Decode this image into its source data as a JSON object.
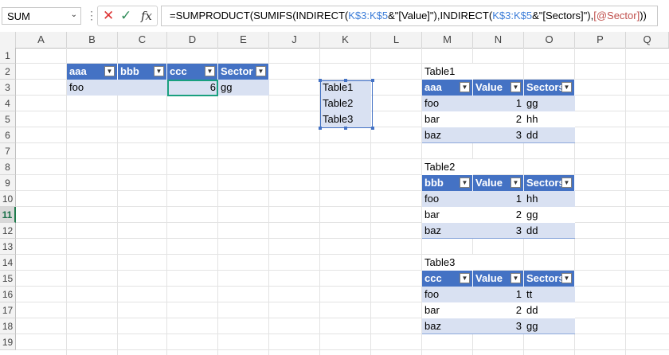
{
  "formula_bar": {
    "name_box": "SUM",
    "formula_parts": [
      {
        "text": "=SUMPRODUCT(SUMIFS(INDIRECT(",
        "c": ""
      },
      {
        "text": "K$3:K$5",
        "c": "ref"
      },
      {
        "text": "&\"[Value]\"),INDIRECT(",
        "c": ""
      },
      {
        "text": "K$3:K$5",
        "c": "ref"
      },
      {
        "text": "&\"[Sectors]\"),",
        "c": ""
      },
      {
        "text": "[@Sector]",
        "c": "ref2"
      },
      {
        "text": "))",
        "c": ""
      }
    ]
  },
  "columns": [
    "A",
    "B",
    "C",
    "D",
    "E",
    "J",
    "K",
    "L",
    "M",
    "N",
    "O",
    "P",
    "Q"
  ],
  "rows": [
    "1",
    "2",
    "3",
    "4",
    "5",
    "6",
    "7",
    "8",
    "9",
    "10",
    "11",
    "12",
    "13",
    "14",
    "15",
    "16",
    "17",
    "18",
    "19"
  ],
  "active_row": "11",
  "main_table": {
    "headers": [
      "aaa",
      "bbb",
      "ccc",
      "Sector"
    ],
    "row": [
      "foo",
      "",
      "6",
      "gg"
    ]
  },
  "list": [
    "Table1",
    "Table2",
    "Table3"
  ],
  "tables": [
    {
      "title": "Table1",
      "headers": [
        "aaa",
        "Value",
        "Sectors"
      ],
      "rows": [
        [
          "foo",
          "1",
          "gg"
        ],
        [
          "bar",
          "2",
          "hh"
        ],
        [
          "baz",
          "3",
          "dd"
        ]
      ]
    },
    {
      "title": "Table2",
      "headers": [
        "bbb",
        "Value",
        "Sectors"
      ],
      "rows": [
        [
          "foo",
          "1",
          "hh"
        ],
        [
          "bar",
          "2",
          "gg"
        ],
        [
          "baz",
          "3",
          "dd"
        ]
      ]
    },
    {
      "title": "Table3",
      "headers": [
        "ccc",
        "Value",
        "Sectors"
      ],
      "rows": [
        [
          "foo",
          "1",
          "tt"
        ],
        [
          "bar",
          "2",
          "dd"
        ],
        [
          "baz",
          "3",
          "gg"
        ]
      ]
    }
  ],
  "colors": {
    "header": "#4472c4",
    "band": "#d9e1f2",
    "selection": "#1aa07f"
  }
}
